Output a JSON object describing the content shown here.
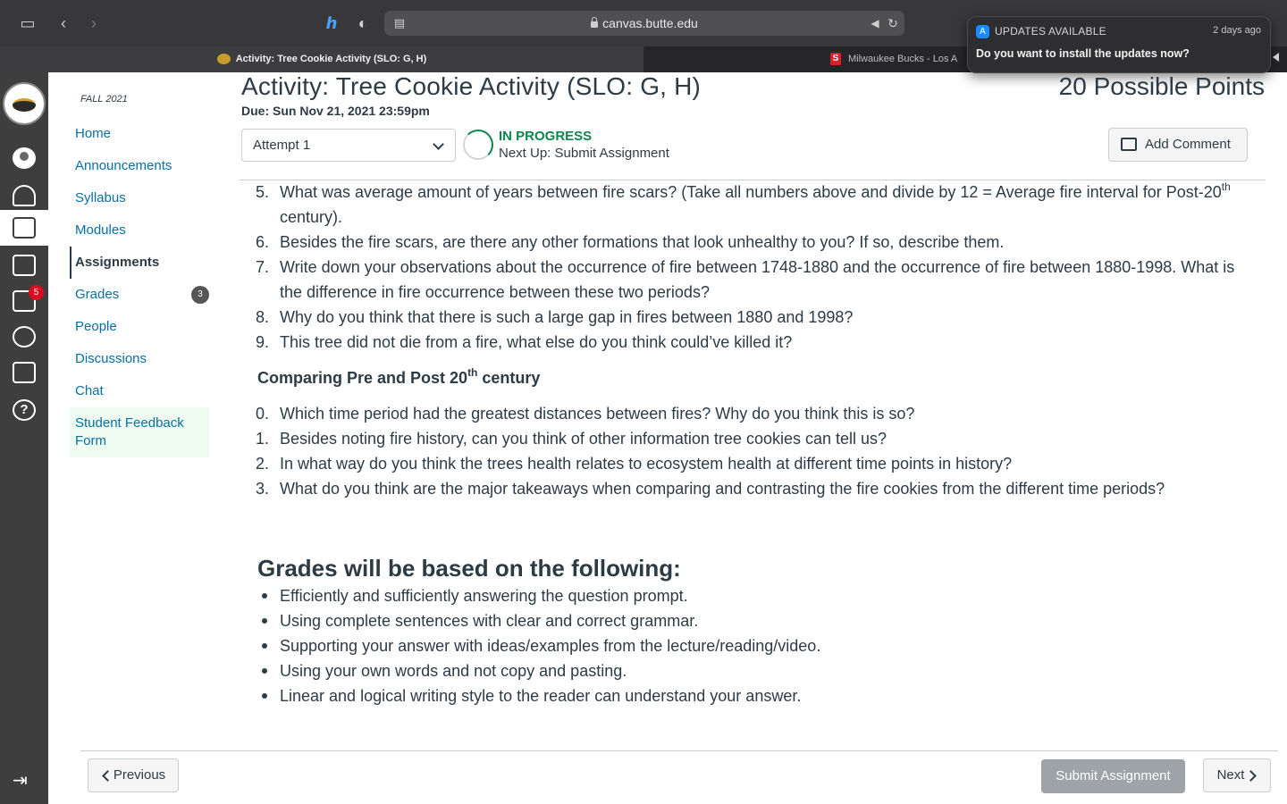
{
  "browser": {
    "url": "canvas.butte.edu",
    "tabs": [
      {
        "label": "Activity: Tree Cookie Activity (SLO: G, H)",
        "active": true
      },
      {
        "label": "Milwaukee Bucks - Los A",
        "active": false
      }
    ]
  },
  "notification": {
    "title": "UPDATES AVAILABLE",
    "time": "2 days ago",
    "message": "Do you want to install the updates now?"
  },
  "global_nav": {
    "inbox_badge": "5"
  },
  "course_nav": {
    "term": "FALL 2021",
    "items": [
      {
        "label": "Home"
      },
      {
        "label": "Announcements"
      },
      {
        "label": "Syllabus"
      },
      {
        "label": "Modules"
      },
      {
        "label": "Assignments",
        "active": true
      },
      {
        "label": "Grades",
        "badge": "3"
      },
      {
        "label": "People"
      },
      {
        "label": "Discussions"
      },
      {
        "label": "Chat"
      },
      {
        "label": "Student Feedback Form"
      }
    ]
  },
  "assignment": {
    "title": "Activity: Tree Cookie Activity (SLO: G, H)",
    "points": "20 Possible Points",
    "due": "Due: Sun Nov 21, 2021 23:59pm",
    "attempt": "Attempt 1",
    "status": "IN PROGRESS",
    "next_up": "Next Up: Submit Assignment",
    "add_comment": "Add Comment"
  },
  "questions_a": [
    {
      "num": "5.",
      "pre": "What was average amount of years between fire scars? (Take all numbers above and divide by 12 = Average fire interval for Post-20",
      "sup": "th",
      "post": " century)."
    },
    {
      "num": "6.",
      "text": "Besides the fire scars, are there any other formations that look unhealthy to you? If so, describe them."
    },
    {
      "num": "7.",
      "text": "Write down your observations about the occurrence of fire between 1748-1880 and the occurrence of fire between 1880-1998. What is the difference in fire occurrence between these two periods?"
    },
    {
      "num": "8.",
      "text": "Why do you think that there is such a large gap in fires between 1880 and 1998?"
    },
    {
      "num": "9.",
      "text": "This tree did not die from a fire, what else do you think could’ve killed it?"
    }
  ],
  "compare_heading": {
    "pre": "Comparing Pre and Post 20",
    "sup": "th",
    "post": " century"
  },
  "questions_b": [
    {
      "num": "0.",
      "text": "Which time period had the greatest distances between fires? Why do you think this is so?"
    },
    {
      "num": "1.",
      "text": "Besides noting fire history, can you think of other information tree cookies can tell us?"
    },
    {
      "num": "2.",
      "text": "In what way do you think the trees health relates to ecosystem health at different time points in history?"
    },
    {
      "num": "3.",
      "text": "What do you think are the major takeaways when comparing and contrasting the fire cookies from the different time periods?"
    }
  ],
  "grades_heading": "Grades will be based on the following:",
  "grading": [
    "Efficiently and sufficiently answering the question prompt.",
    "Using complete sentences with clear and correct grammar.",
    "Supporting your answer with ideas/examples from the lecture/reading/video.",
    "Using your own words and not copy and pasting.",
    "Linear and logical writing style to the reader can understand your answer."
  ],
  "footer": {
    "previous": "Previous",
    "submit": "Submit Assignment",
    "next": "Next"
  }
}
